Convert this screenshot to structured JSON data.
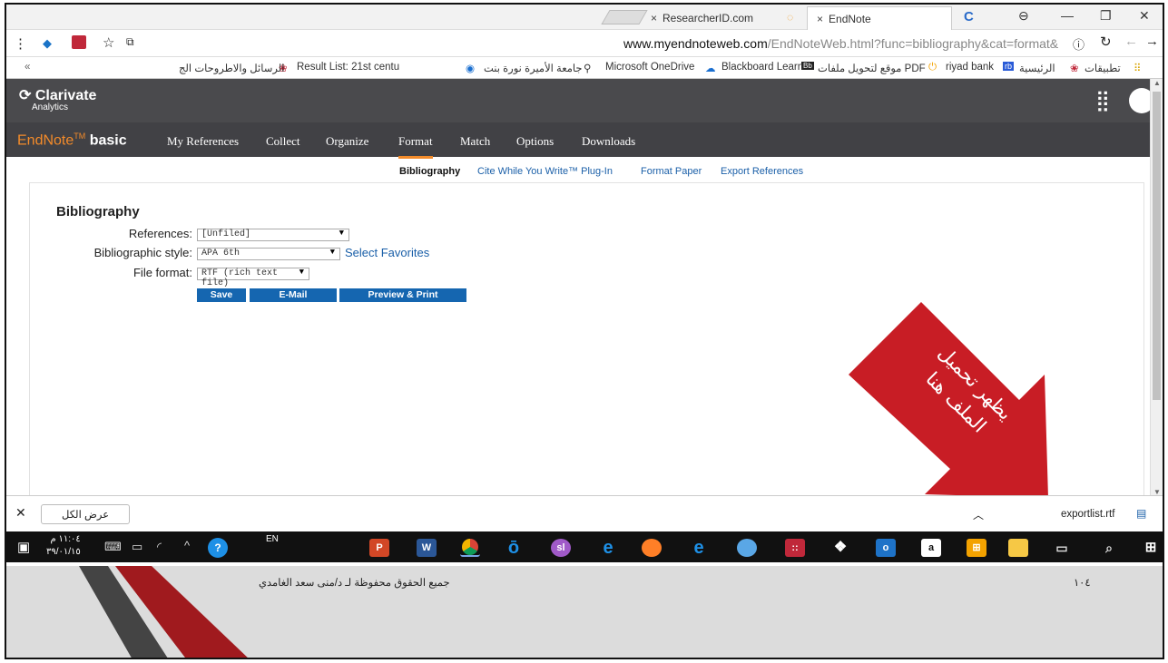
{
  "tabs": [
    {
      "label": "ResearcherID.com"
    },
    {
      "label": "EndNote"
    }
  ],
  "address": {
    "host": "www.myendnoteweb.com",
    "path": "/EndNoteWeb.html?func=bibliography&cat=format&"
  },
  "bookmarks": [
    "تطبيقات",
    "الرئيسية",
    "riyad bank",
    "موقع لتحويل ملفات PDF",
    "Blackboard Learn",
    "Microsoft OneDrive",
    "جامعة الأميرة نورة بنت",
    "Result List: 21st centu",
    "الرسائل والاطروحات الج"
  ],
  "header": {
    "company": "Clarivate",
    "company_sub": "Analytics"
  },
  "endnote": {
    "brand": "EndNote",
    "brand_tm": "TM",
    "brand_basic": "basic",
    "nav": [
      "My References",
      "Collect",
      "Organize",
      "Format",
      "Match",
      "Options",
      "Downloads"
    ],
    "active_nav": "Format"
  },
  "subnav": [
    "Bibliography",
    "Cite While You Write™ Plug-In",
    "Format Paper",
    "Export References"
  ],
  "form": {
    "title": "Bibliography",
    "references_label": "References:",
    "references_value": "[Unfiled]",
    "style_label": "Bibliographic style:",
    "style_value": "APA 6th",
    "select_favorites": "Select Favorites",
    "format_label": "File format:",
    "format_value": "RTF (rich text file)",
    "buttons": {
      "save": "Save",
      "email": "E-Mail",
      "preview": "Preview & Print"
    }
  },
  "annotation": {
    "line1": "يظهر تحميل",
    "line2": "الملف هنا",
    "color": "#c81d25"
  },
  "download_bar": {
    "show_all": "عرض الكل",
    "file": "exportlist.rtf"
  },
  "taskbar": {
    "time": "١١:٠٤ م",
    "date": "٣٩/٠١/١٥",
    "lang": "EN"
  },
  "slide_footer": {
    "copyright": "جميع الحقوق محفوظة لـ د/منى سعد الغامدي",
    "page": "١٠٤"
  }
}
